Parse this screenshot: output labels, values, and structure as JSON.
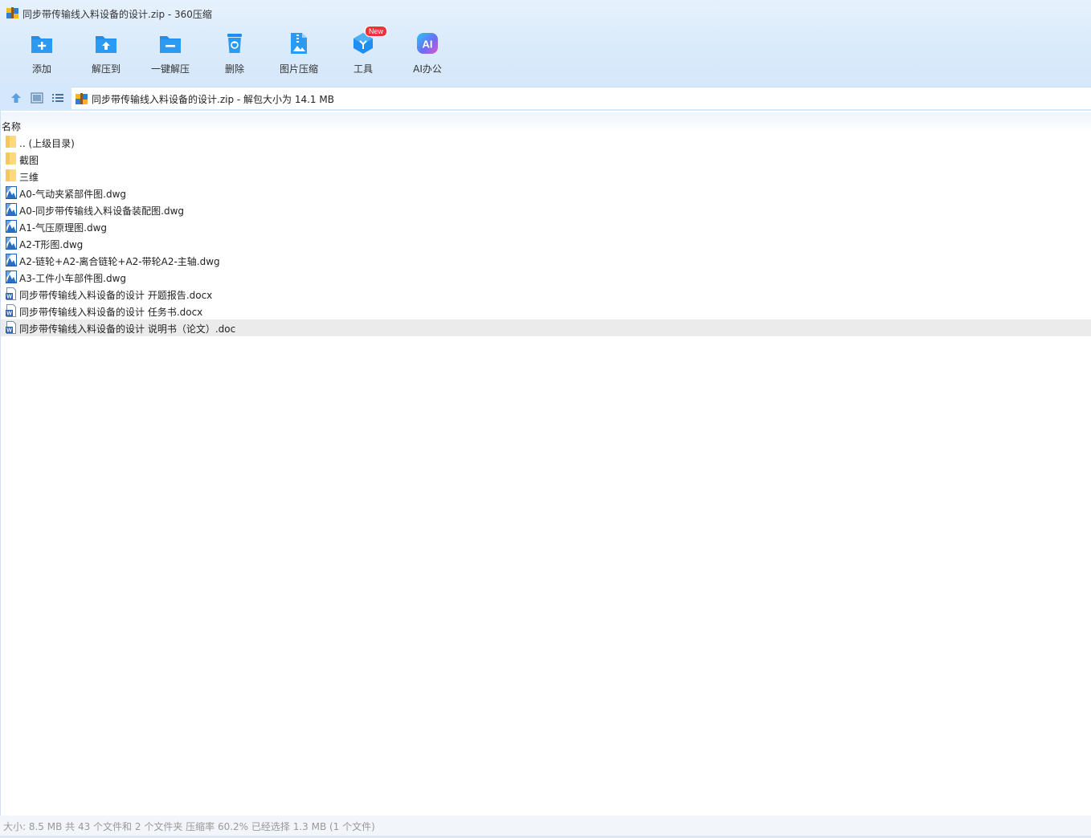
{
  "window": {
    "title": "同步带传输线入料设备的设计.zip - 360压缩"
  },
  "toolbar": {
    "items": [
      {
        "label": "添加",
        "icon": "add-folder-icon"
      },
      {
        "label": "解压到",
        "icon": "extract-to-icon"
      },
      {
        "label": "一键解压",
        "icon": "one-click-extract-icon"
      },
      {
        "label": "删除",
        "icon": "trash-icon"
      },
      {
        "label": "图片压缩",
        "icon": "image-compress-icon"
      },
      {
        "label": "工具",
        "icon": "tools-icon",
        "badge": "New"
      },
      {
        "label": "AI办公",
        "icon": "ai-office-icon"
      }
    ]
  },
  "address": {
    "text": "同步带传输线入料设备的设计.zip - 解包大小为 14.1 MB"
  },
  "list": {
    "column_name": "名称",
    "rows": [
      {
        "name": ".. (上级目录)",
        "type": "folder"
      },
      {
        "name": "截图",
        "type": "folder"
      },
      {
        "name": "三维",
        "type": "folder"
      },
      {
        "name": "A0-气动夹紧部件图.dwg",
        "type": "dwg"
      },
      {
        "name": "A0-同步带传输线入料设备装配图.dwg",
        "type": "dwg"
      },
      {
        "name": "A1-气压原理图.dwg",
        "type": "dwg"
      },
      {
        "name": "A2-T形图.dwg",
        "type": "dwg"
      },
      {
        "name": "A2-链轮+A2-离合链轮+A2-带轮A2-主轴.dwg",
        "type": "dwg"
      },
      {
        "name": "A3-工件小车部件图.dwg",
        "type": "dwg"
      },
      {
        "name": "同步带传输线入料设备的设计 开题报告.docx",
        "type": "word"
      },
      {
        "name": "同步带传输线入料设备的设计 任务书.docx",
        "type": "word"
      },
      {
        "name": "同步带传输线入料设备的设计 说明书（论文）.doc",
        "type": "word",
        "selected": true
      }
    ]
  },
  "status": {
    "text": "大小: 8.5 MB 共 43 个文件和 2 个文件夹 压缩率 60.2% 已经选择 1.3 MB (1 个文件)"
  },
  "colors": {
    "toolbar_bg": "#d9eafb",
    "icon_blue": "#1e8ff0",
    "badge_red": "#f2313b",
    "selected_row": "#ebebeb"
  }
}
